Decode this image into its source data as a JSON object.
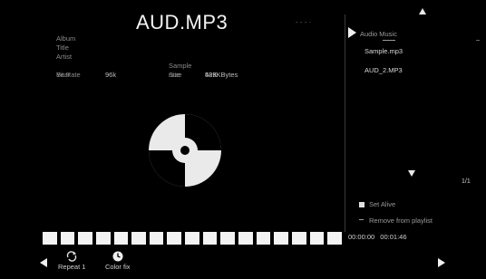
{
  "header": {
    "title": "AUD.MP3",
    "subtitle": "- - - ·"
  },
  "info": {
    "album_label": "Album",
    "title_label": "Title",
    "artist_label": "Artist",
    "bitrate_label": "Bit Rate",
    "bitrate_value": "96k",
    "samplerate_label": "Sample rate",
    "samplerate_value": "48K",
    "year_label": "Year",
    "size_label": "Size",
    "size_value": "529KBytes"
  },
  "playlist": {
    "folder_label": "Audio Music",
    "files": [
      "Sample.mp3",
      "AUD_2.MP3"
    ],
    "page": "1/1"
  },
  "options": {
    "set_alive": "Set Alive",
    "remove_label": "Remove from playlist"
  },
  "time": {
    "current": "00:00:00",
    "total": "00:01:46"
  },
  "controls": {
    "repeat_label": "Repeat 1",
    "color_label": "Color fix"
  },
  "progress": {
    "fraction": 1.0,
    "segments": 17
  },
  "colors": {
    "background": "#000000",
    "foreground": "#f0f0f0",
    "muted": "#8a8a8a"
  }
}
